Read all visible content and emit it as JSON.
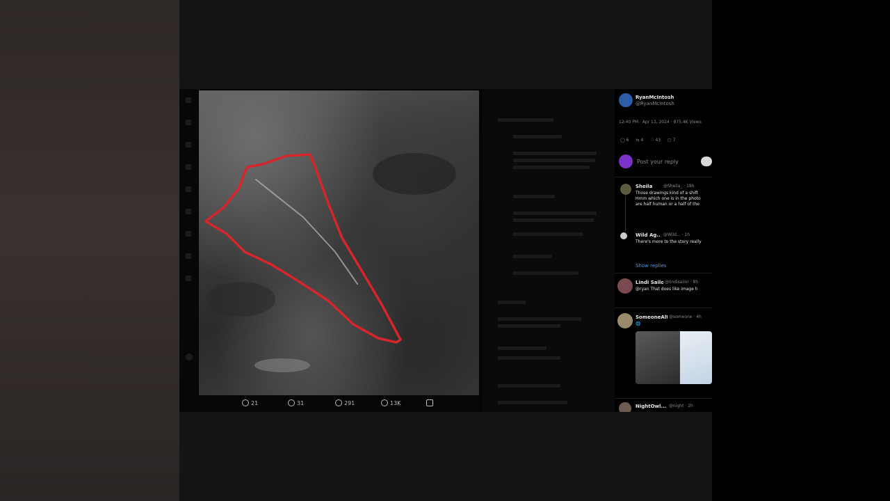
{
  "video_frame": {
    "post_actions": [
      {
        "icon": "reply-icon",
        "count": "21"
      },
      {
        "icon": "repost-icon",
        "count": "31"
      },
      {
        "icon": "like-icon",
        "count": "291"
      },
      {
        "icon": "views-icon",
        "count": "13K"
      },
      {
        "icon": "share-icon",
        "count": ""
      }
    ]
  },
  "tweet": {
    "author_name": "RyanMcIntosh",
    "author_handle": "@RyanMcIntosh",
    "timestamp": "12:40 PM · Apr 13, 2024 · 875.4K Views",
    "stats": [
      {
        "icon": "reply-icon",
        "count": "6"
      },
      {
        "icon": "repost-icon",
        "count": "4"
      },
      {
        "icon": "like-icon",
        "count": "43"
      },
      {
        "icon": "bookmark-icon",
        "count": "7"
      }
    ],
    "reply_placeholder": "Post your reply",
    "reply_button_label": "",
    "replies": [
      {
        "name": "Sheila",
        "handle": "@Sheila_ · 18h",
        "text_lines": [
          "Those drawings kind of a shift",
          "Hmm which one is in the photo",
          "are half human or a half of the"
        ],
        "show_replies": ""
      },
      {
        "name": "Wild Ag...",
        "handle": "@Wild... · 1h",
        "text_lines": [
          "There's more to the story really"
        ],
        "show_replies": "Show replies"
      },
      {
        "name": "Lindi Sailor",
        "handle": "@lindisailor · 8h",
        "text_lines": [
          "@ryan That does like image h"
        ],
        "show_replies": ""
      },
      {
        "name": "SomeoneAlt...",
        "handle": "@someone · 4h",
        "text_lines": [
          "🌐"
        ],
        "show_replies": ""
      },
      {
        "name": "NightOwl...",
        "handle": "@night · 2h",
        "text_lines": [],
        "show_replies": ""
      }
    ]
  }
}
